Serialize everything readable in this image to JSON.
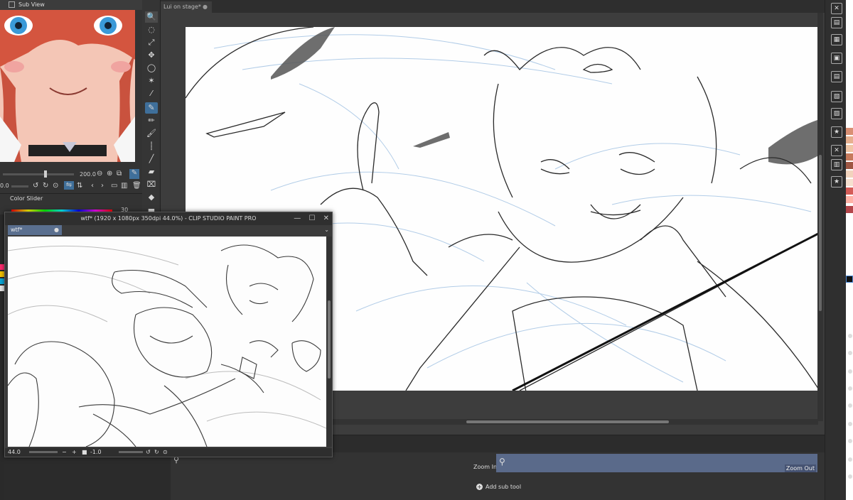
{
  "subview": {
    "title": "Sub View",
    "zoom_value": "200.0",
    "rotate_value": "0.0",
    "icons": [
      "zoom-out-icon",
      "zoom-in-icon",
      "fit-icon",
      "eyedropper-icon"
    ]
  },
  "color_slider": {
    "title": "Color Slider",
    "value": "30"
  },
  "main_canvas": {
    "tab_label": "Lui on stage*",
    "tab_close": "●"
  },
  "float_window": {
    "title": "wtf* (1920 x 1080px 350dpi 44.0%)  - CLIP STUDIO PAINT PRO",
    "tab_label": "wtf*",
    "tab_close": "●",
    "zoom": "44.0",
    "rotation": "-1.0",
    "buttons": {
      "minimize": "—",
      "maximize": "☐",
      "close": "✕"
    }
  },
  "navigator": {
    "zoom_in_label": "Zoom In",
    "zoom_out_label": "Zoom Out",
    "add_sub_tool_label": "Add sub tool"
  },
  "colors": {
    "active_tool": "#3f6f9a",
    "tab_highlight": "#5a6f8f",
    "zoom_field": "#5a6a8a"
  }
}
